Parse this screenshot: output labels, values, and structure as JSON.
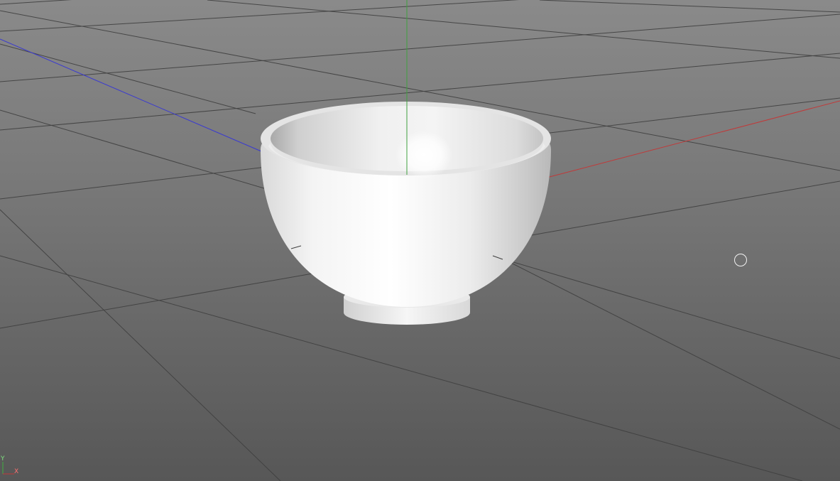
{
  "viewport": {
    "background_color": "#747474",
    "grid_color": "#3a3a3a",
    "axis_colors": {
      "x": "#c03a3a",
      "y": "#3fa03f",
      "z": "#3a3ad0"
    },
    "object": "bowl",
    "object_color": "#f2f2f2",
    "cursor": "circle-cursor-icon"
  },
  "axis_gizmo": {
    "y_label": "Y",
    "x_label": "X"
  }
}
